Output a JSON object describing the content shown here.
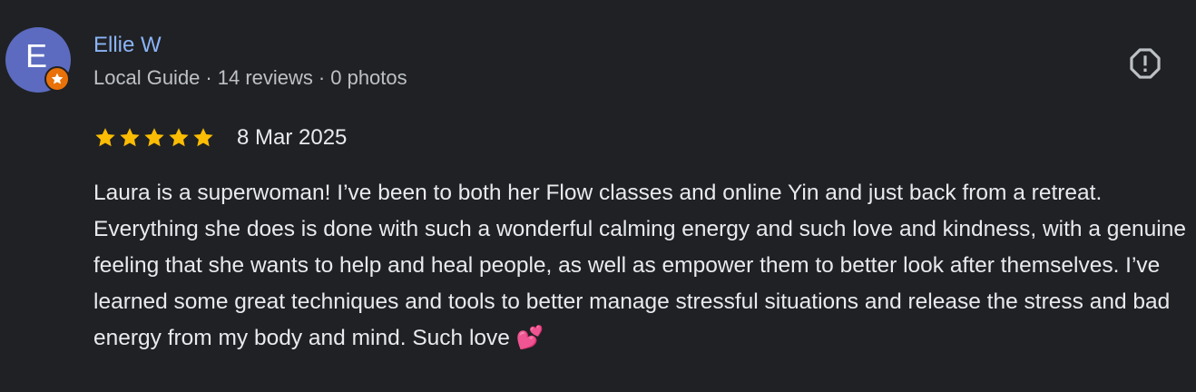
{
  "reviewer": {
    "initial": "E",
    "name": "Ellie W",
    "badge": "Local Guide",
    "reviews": "14 reviews",
    "photos": "0 photos",
    "separator": "·",
    "avatar_color": "#5c6bc0",
    "badge_color": "#e8710a"
  },
  "rating": {
    "stars": 5,
    "max_stars": 5,
    "star_color": "#fbbc04",
    "date": "8 Mar 2025"
  },
  "review": {
    "text": "Laura is a superwoman! I’ve been to both her Flow classes and online Yin and just back from a retreat. Everything she does is done with such a wonderful calming energy and such love and kindness, with a genuine feeling that she wants to help and heal people, as well as empower them to better look after themselves. I’ve learned some great techniques and tools to better manage stressful situations and release the stress and bad energy from my body and mind. Such love 💕"
  },
  "icons": {
    "report": "report-octagon-icon",
    "badge": "local-guide-star-icon",
    "star": "star-icon"
  },
  "colors": {
    "background": "#202124",
    "name_link": "#8ab4f8",
    "meta_text": "#bdc1c6",
    "body_text": "#e8eaed"
  }
}
